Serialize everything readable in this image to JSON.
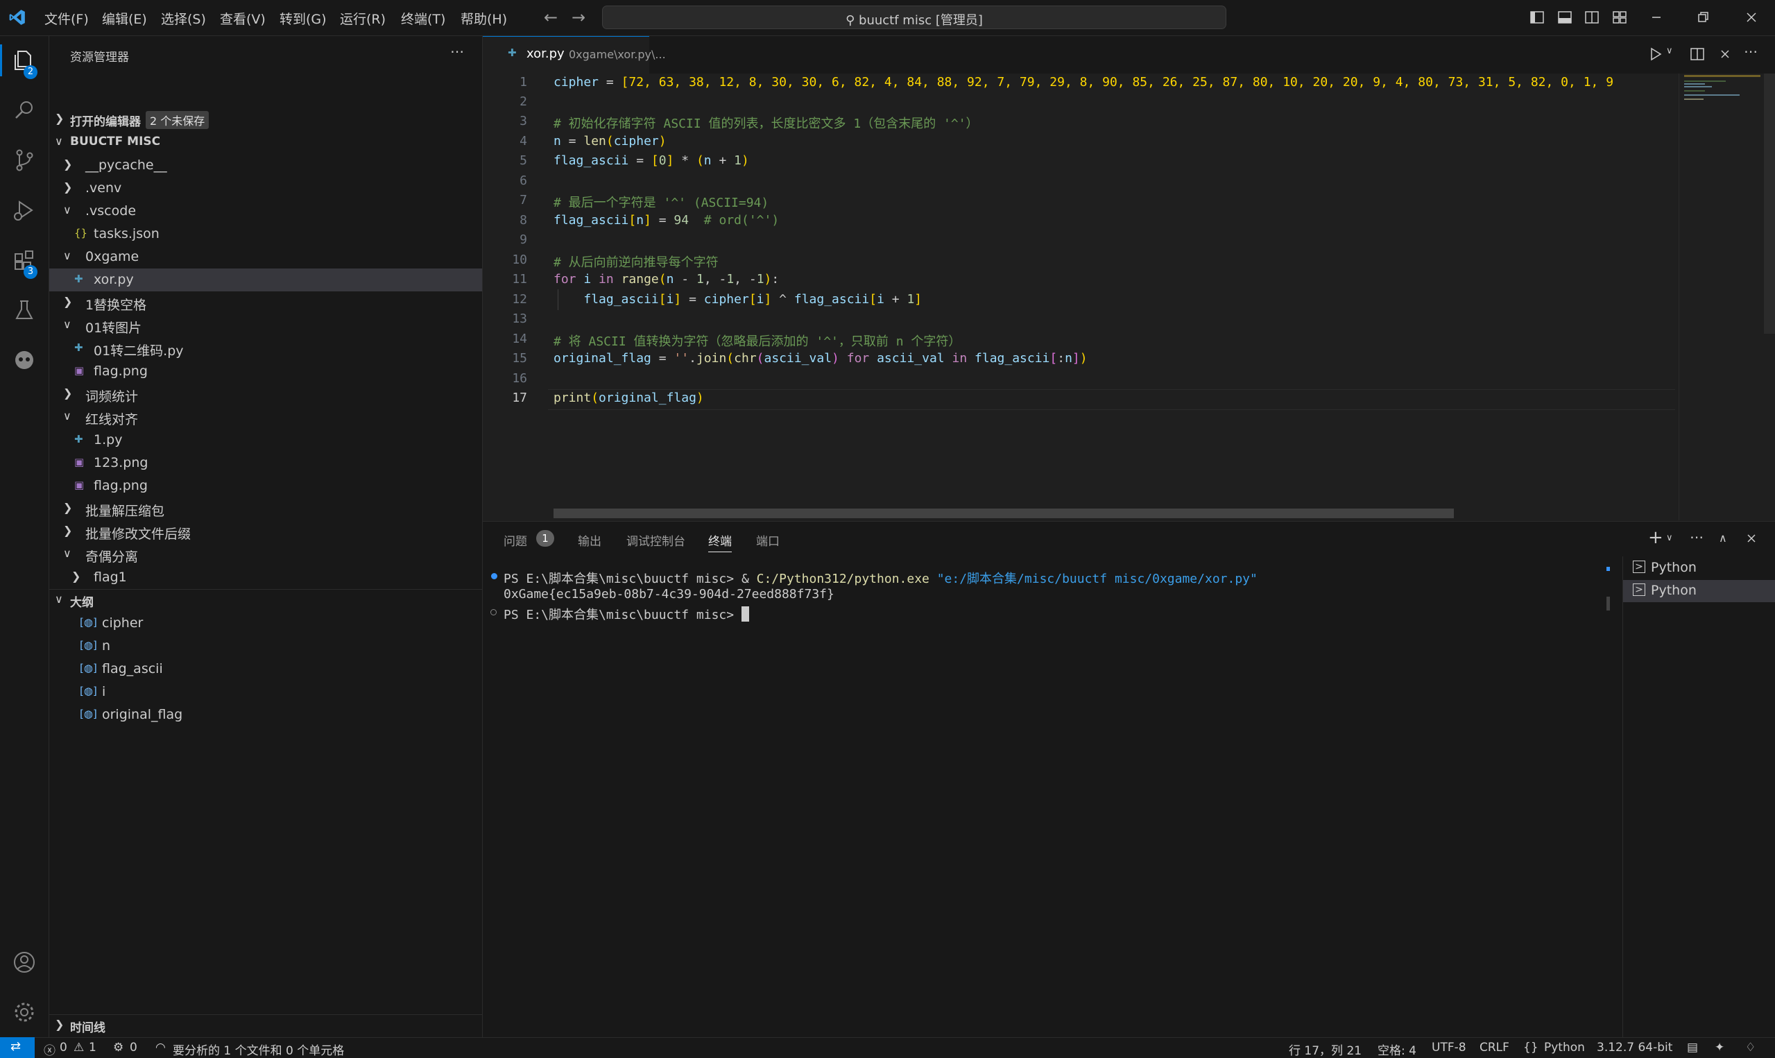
{
  "titlebar": {
    "menu": [
      "文件(F)",
      "编辑(E)",
      "选择(S)",
      "查看(V)",
      "转到(G)",
      "运行(R)",
      "终端(T)",
      "帮助(H)"
    ],
    "search": "buuctf misc [管理员]"
  },
  "activity": {
    "explorer_badge": "2",
    "extensions_badge": "3"
  },
  "sidebar": {
    "title": "资源管理器",
    "open_editors": "打开的编辑器",
    "unsaved": "2 个未保存",
    "workspace": "BUUCTF MISC",
    "tree": {
      "pycache": "__pycache__",
      "venv": ".venv",
      "vscode": ".vscode",
      "tasks": "tasks.json",
      "oxgame": "0xgame",
      "xor": "xor.py",
      "f1": "1替换空格",
      "f2": "01转图片",
      "f2a": "01转二维码.py",
      "f2b": "flag.png",
      "f3": "词频统计",
      "f4": "红线对齐",
      "f4a": "1.py",
      "f4b": "123.png",
      "f4c": "flag.png",
      "f5": "批量解压缩包",
      "f6": "批量修改文件后缀",
      "f7": "奇偶分离",
      "f7a": "flag1"
    },
    "outline_title": "大纲",
    "outline": [
      "cipher",
      "n",
      "flag_ascii",
      "i",
      "original_flag"
    ],
    "timeline": "时间线"
  },
  "editor": {
    "tab_name": "xor.py",
    "tab_path": "0xgame\\xor.py\\...",
    "line_numbers": [
      "1",
      "2",
      "3",
      "4",
      "5",
      "6",
      "7",
      "8",
      "9",
      "10",
      "11",
      "12",
      "13",
      "14",
      "15",
      "16",
      "17"
    ],
    "cipher_values": "[72, 63, 38, 12, 8, 30, 30, 6, 82, 4, 84, 88, 92, 7, 79, 29, 8, 90, 85, 26, 25, 87, 80, 10, 20, 20, 9, 4, 80, 73, 31, 5, 82, 0, 1, 9",
    "comment3": "# 初始化存储字符 ASCII 值的列表，长度比密文多 1（包含末尾的 '^'）",
    "comment7": "# 最后一个字符是 '^' (ASCII=94)",
    "comment8": "# ord('^')",
    "comment10": "# 从后向前逆向推导每个字符",
    "comment14": "# 将 ASCII 值转换为字符（忽略最后添加的 '^'，只取前 n 个字符）"
  },
  "panel": {
    "tabs": [
      "问题",
      "输出",
      "调试控制台",
      "终端",
      "端口"
    ],
    "problems_count": "1",
    "term_line1_prompt": "PS E:\\脚本合集\\misc\\buuctf misc> ",
    "term_line1_amp": "& ",
    "term_line1_exe": "C:/Python312/python.exe",
    "term_line1_arg": " \"e:/脚本合集/misc/buuctf misc/0xgame/xor.py\"",
    "term_line2": "0xGame{ec15a9eb-08b7-4c39-904d-27eed888f73f}",
    "term_line3": "PS E:\\脚本合集\\misc\\buuctf misc> ",
    "terminals": [
      "Python",
      "Python"
    ]
  },
  "statusbar": {
    "errors": "0",
    "warnings": "1",
    "ports": "0",
    "analysis": "要分析的 1 个文件和 0 个单元格",
    "position": "行 17，列 21",
    "spaces": "空格: 4",
    "encoding": "UTF-8",
    "eol": "CRLF",
    "language": "Python",
    "interpreter": "3.12.7 64-bit"
  }
}
